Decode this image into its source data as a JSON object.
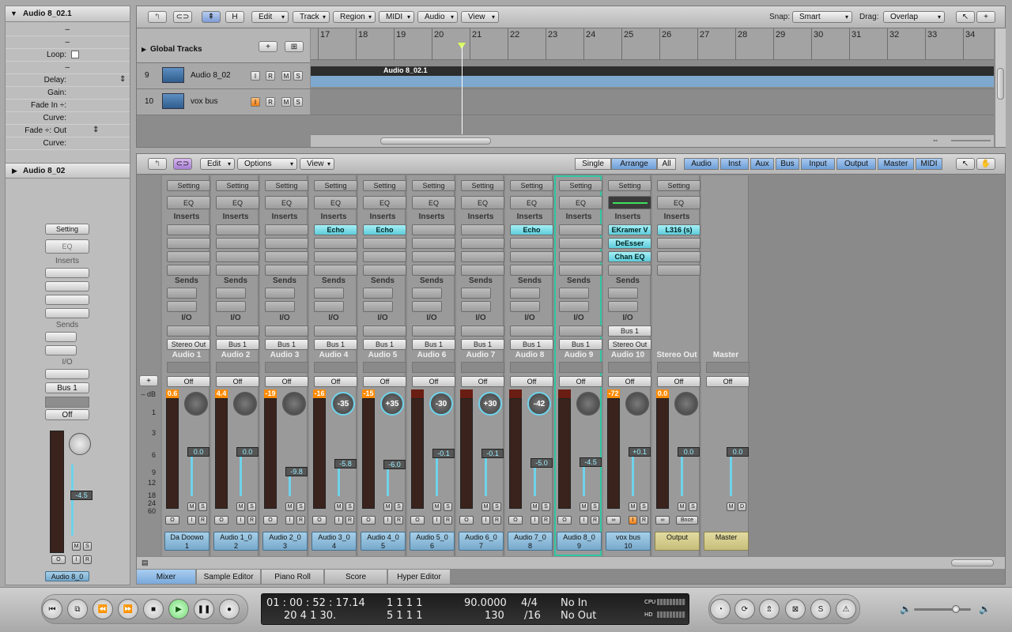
{
  "inspector": {
    "region_title": "Audio 8_02.1",
    "params": [
      {
        "label": "",
        "value": "–"
      },
      {
        "label": "",
        "value": "–"
      },
      {
        "label": "Loop:",
        "value": ""
      },
      {
        "label": "",
        "value": "–"
      },
      {
        "label": "Delay:",
        "value": ""
      },
      {
        "label": "Gain:",
        "value": ""
      },
      {
        "label": "Fade In ÷:",
        "value": ""
      },
      {
        "label": "Curve:",
        "value": ""
      },
      {
        "label": "Fade ÷: Out",
        "value": ""
      },
      {
        "label": "Curve:",
        "value": ""
      }
    ],
    "track_title": "Audio 8_02",
    "strip": {
      "setting": "Setting",
      "eq": "EQ",
      "inserts": "Inserts",
      "sends": "Sends",
      "io": "I/O",
      "output": "Bus 1",
      "automation": "Off",
      "volume": "-4.5",
      "name": "Audio 8_0"
    }
  },
  "arrange": {
    "menus": [
      "Edit",
      "Track",
      "Region",
      "MIDI",
      "Audio",
      "View"
    ],
    "h_button": "H",
    "snap_label": "Snap:",
    "snap_value": "Smart",
    "drag_label": "Drag:",
    "drag_value": "Overlap",
    "global_tracks": "Global Tracks",
    "ruler": [
      "17",
      "18",
      "19",
      "20",
      "21",
      "22",
      "23",
      "24",
      "25",
      "26",
      "27",
      "28",
      "29",
      "30",
      "31",
      "32",
      "33",
      "34"
    ],
    "tracks": [
      {
        "num": "9",
        "name": "Audio 8_02",
        "region": "Audio 8_02.1"
      },
      {
        "num": "10",
        "name": "vox bus",
        "region": ""
      }
    ],
    "track_buttons": [
      "I",
      "R",
      "M",
      "S"
    ]
  },
  "mixer": {
    "menus": [
      "Edit",
      "Options",
      "View"
    ],
    "modes": [
      "Single",
      "Arrange",
      "All"
    ],
    "filters": [
      "Audio",
      "Inst",
      "Aux",
      "Bus",
      "Input",
      "Output",
      "Master",
      "MIDI"
    ],
    "labels": {
      "setting": "Setting",
      "eq": "EQ",
      "inserts": "Inserts",
      "sends": "Sends",
      "io": "I/O",
      "off": "Off"
    },
    "scale": [
      "– dB",
      "1",
      "3",
      "6",
      "9",
      "12",
      "18",
      "24",
      "60"
    ],
    "strips": [
      {
        "name": "Audio 1",
        "label1": "Da Doowo",
        "label2": "1",
        "output": "Stereo Out",
        "peak": "0.6",
        "pan": "",
        "vol": "0.0",
        "inserts": [
          "",
          "",
          "",
          ""
        ],
        "vol_level": 0.6
      },
      {
        "name": "Audio 2",
        "label1": "Audio 1_0",
        "label2": "2",
        "output": "Bus 1",
        "peak": "4.4",
        "pan": "",
        "vol": "0.0",
        "inserts": [
          "",
          "",
          "",
          ""
        ],
        "vol_level": 0.6
      },
      {
        "name": "Audio 3",
        "label1": "Audio 2_0",
        "label2": "3",
        "output": "Bus 1",
        "peak": "-19",
        "pan": "",
        "vol": "-9.8",
        "inserts": [
          "",
          "",
          "",
          ""
        ],
        "vol_level": 0.35
      },
      {
        "name": "Audio 4",
        "label1": "Audio 3_0",
        "label2": "4",
        "output": "Bus 1",
        "peak": "-16",
        "pan": "-35",
        "vol": "-5.8",
        "inserts": [
          "Echo",
          "",
          "",
          ""
        ],
        "vol_level": 0.45
      },
      {
        "name": "Audio 5",
        "label1": "Audio 4_0",
        "label2": "5",
        "output": "Bus 1",
        "peak": "-15",
        "pan": "+35",
        "vol": "-6.0",
        "inserts": [
          "Echo",
          "",
          "",
          ""
        ],
        "vol_level": 0.44
      },
      {
        "name": "Audio 6",
        "label1": "Audio 5_0",
        "label2": "6",
        "output": "Bus 1",
        "peak": "",
        "pan": "-30",
        "vol": "-0.1",
        "inserts": [
          "",
          "",
          "",
          ""
        ],
        "vol_level": 0.58
      },
      {
        "name": "Audio 7",
        "label1": "Audio 6_0",
        "label2": "7",
        "output": "Bus 1",
        "peak": "",
        "pan": "+30",
        "vol": "-0.1",
        "inserts": [
          "",
          "",
          "",
          ""
        ],
        "vol_level": 0.58
      },
      {
        "name": "Audio 8",
        "label1": "Audio 7_0",
        "label2": "8",
        "output": "Bus 1",
        "peak": "",
        "pan": "-42",
        "vol": "-5.0",
        "inserts": [
          "Echo",
          "",
          "",
          ""
        ],
        "vol_level": 0.46
      },
      {
        "name": "Audio 9",
        "label1": "Audio 8_0",
        "label2": "9",
        "output": "Bus 1",
        "peak": "",
        "pan": "",
        "vol": "-4.5",
        "inserts": [
          "",
          "",
          "",
          ""
        ],
        "vol_level": 0.47
      },
      {
        "name": "Audio 10",
        "label1": "vox bus",
        "label2": "10",
        "output": "Stereo Out",
        "bus": "Bus 1",
        "peak": "-72",
        "pan": "",
        "vol": "+0.1",
        "inserts": [
          "EKramer V",
          "DeEsser",
          "Chan EQ",
          ""
        ],
        "vol_level": 0.6
      },
      {
        "name": "Stereo Out",
        "label1": "Output",
        "label2": "",
        "output": "",
        "peak": "0.0",
        "pan": "",
        "vol": "0.0",
        "inserts": [
          "L316 (s)",
          "",
          "",
          ""
        ],
        "vol_level": 0.6
      },
      {
        "name": "Master",
        "label1": "Master",
        "label2": "",
        "output": "",
        "peak": "",
        "pan": "",
        "vol": "0.0",
        "inserts": [],
        "vol_level": 0.6
      }
    ],
    "bounce_label": "Bnce"
  },
  "tabs": [
    "Mixer",
    "Sample Editor",
    "Piano Roll",
    "Score",
    "Hyper Editor"
  ],
  "transport": {
    "time": "01 : 00 : 52 : 17.14",
    "time2": "20   4   1   30.",
    "bars": "1     1     1     1",
    "bars2": "5     1     1     1",
    "tempo": "90.0000",
    "tempo2": "130",
    "sig": "4/4",
    "sig2": "/16",
    "in": "No In",
    "out": "No Out",
    "cpu": "CPU",
    "hd": "HD"
  }
}
